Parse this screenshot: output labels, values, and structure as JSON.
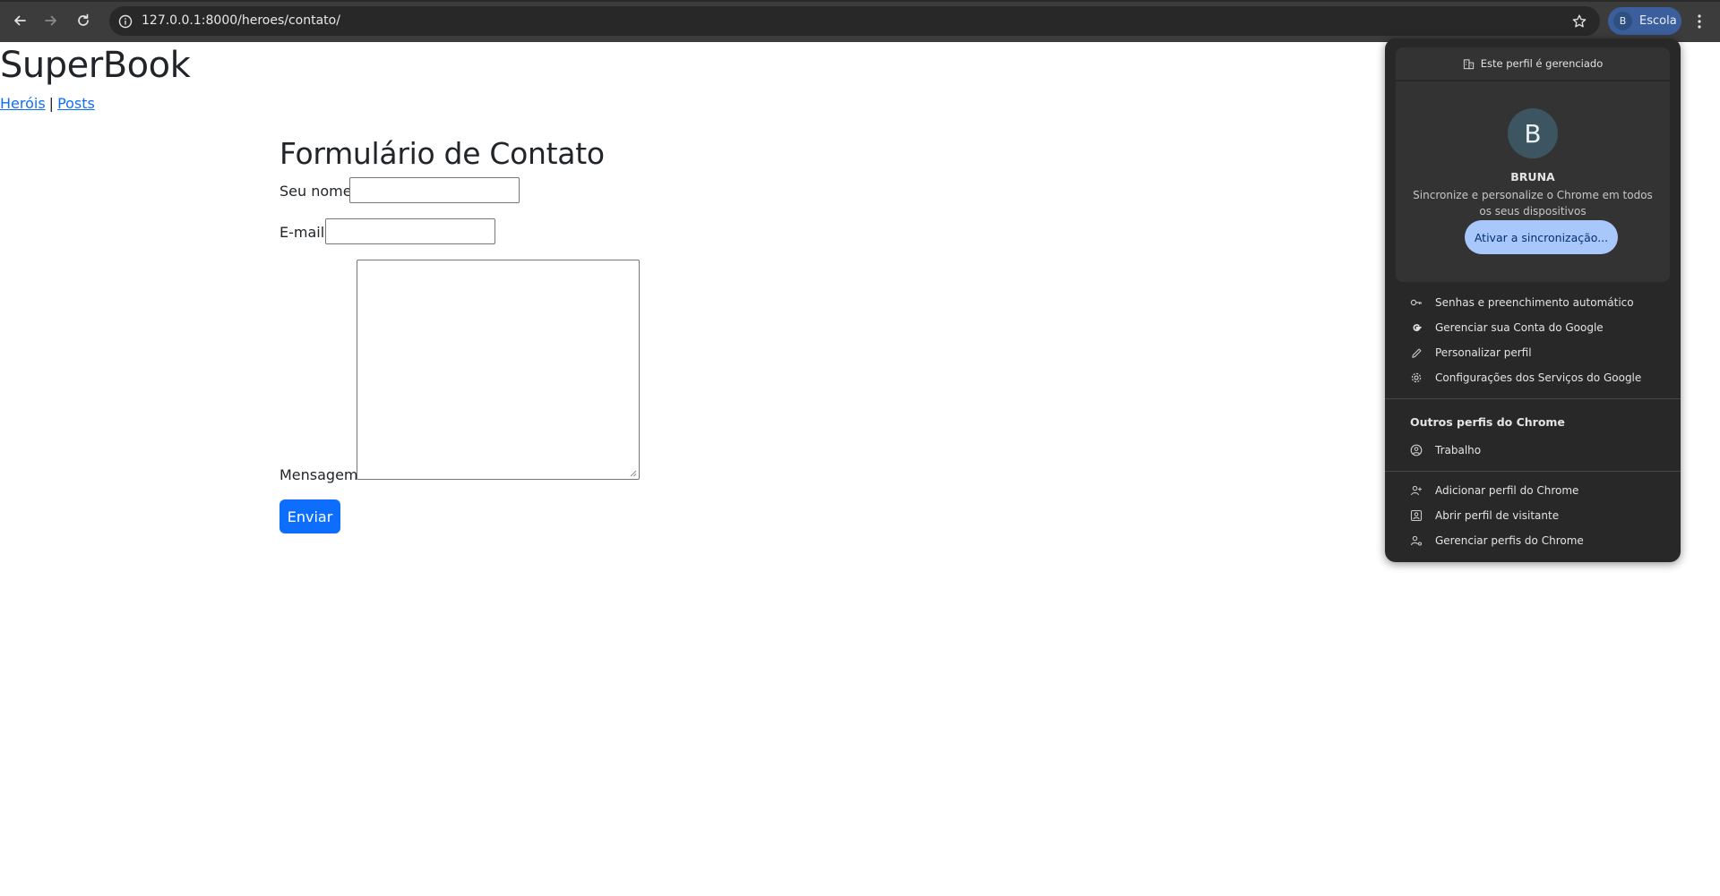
{
  "browser": {
    "url": "127.0.0.1:8000/heroes/contato/",
    "profile_chip": {
      "initial": "B",
      "label": "Escola"
    }
  },
  "page": {
    "site_title": "SuperBook",
    "nav": {
      "heroes": "Heróis",
      "separator": "|",
      "posts": "Posts"
    },
    "form": {
      "title": "Formulário de Contato",
      "name_label": "Seu nome:",
      "name_value": "",
      "email_label": "E-mail:",
      "email_value": "",
      "message_label": "Mensagem:",
      "message_value": "",
      "submit_label": "Enviar"
    }
  },
  "profile_menu": {
    "managed_notice": "Este perfil é gerenciado",
    "avatar_initial": "B",
    "name": "BRUNA",
    "description": "Sincronize e personalize o Chrome em todos os seus dispositivos",
    "sync_button": "Ativar a sincronização...",
    "items": [
      {
        "icon": "key-icon",
        "label": "Senhas e preenchimento automático"
      },
      {
        "icon": "google-icon",
        "label": "Gerenciar sua Conta do Google"
      },
      {
        "icon": "pencil-icon",
        "label": "Personalizar perfil"
      },
      {
        "icon": "gear-icon",
        "label": "Configurações dos Serviços do Google"
      }
    ],
    "other_profiles_title": "Outros perfis do Chrome",
    "other_profiles": [
      {
        "icon": "person-circle-icon",
        "label": "Trabalho"
      }
    ],
    "footer_items": [
      {
        "icon": "add-person-icon",
        "label": "Adicionar perfil do Chrome"
      },
      {
        "icon": "guest-icon",
        "label": "Abrir perfil de visitante"
      },
      {
        "icon": "manage-profiles-icon",
        "label": "Gerenciar perfis do Chrome"
      }
    ]
  }
}
